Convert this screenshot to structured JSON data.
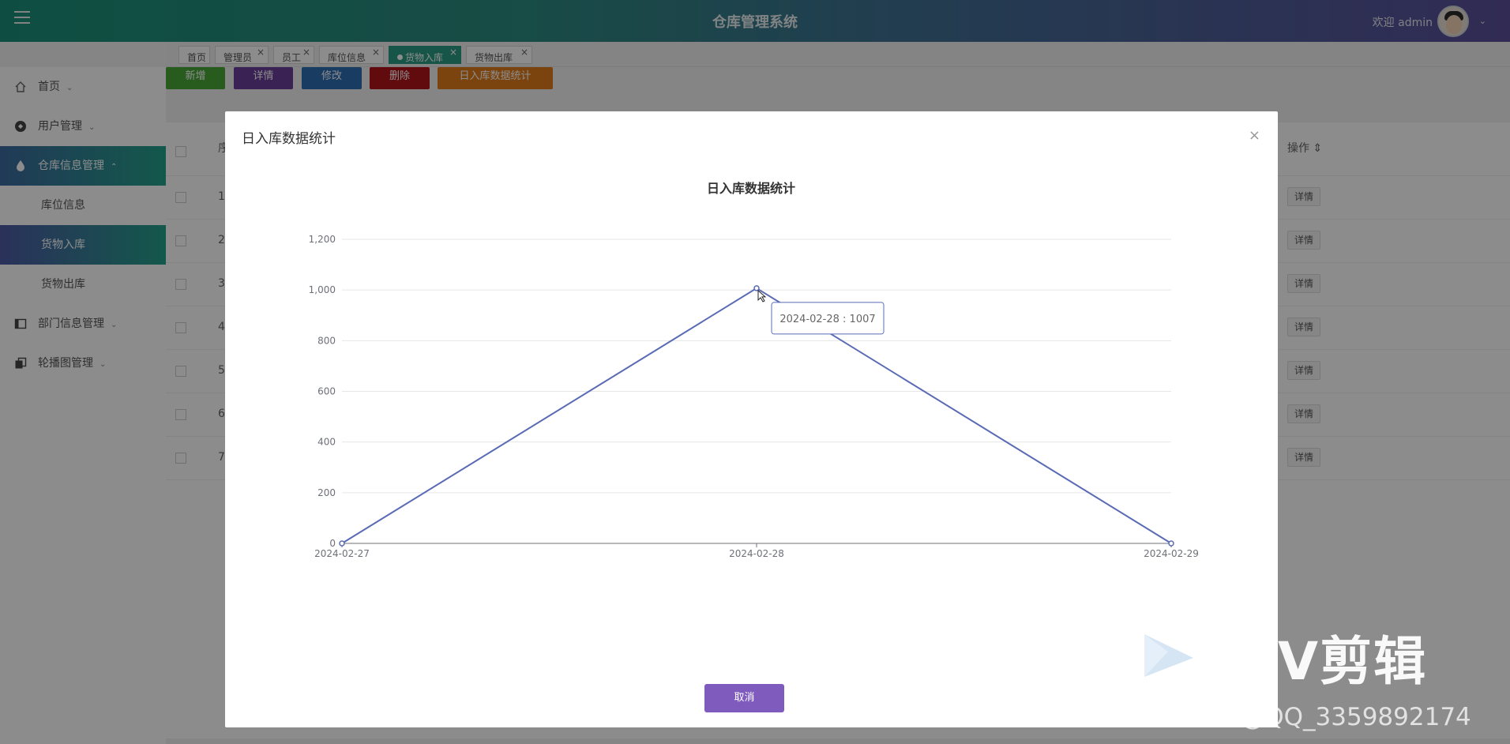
{
  "header": {
    "title": "仓库管理系统",
    "welcome": "欢迎 admin"
  },
  "tabs": [
    {
      "label": "首页",
      "closable": false,
      "active": false
    },
    {
      "label": "管理员",
      "closable": true,
      "active": false
    },
    {
      "label": "员工",
      "closable": true,
      "active": false
    },
    {
      "label": "库位信息",
      "closable": true,
      "active": false
    },
    {
      "label": "货物入库",
      "closable": true,
      "active": true
    },
    {
      "label": "货物出库",
      "closable": true,
      "active": false
    }
  ],
  "sidebar": {
    "items": [
      {
        "label": "首页"
      },
      {
        "label": "用户管理"
      },
      {
        "label": "仓库信息管理"
      },
      {
        "label": "库位信息"
      },
      {
        "label": "货物入库"
      },
      {
        "label": "货物出库"
      },
      {
        "label": "部门信息管理"
      },
      {
        "label": "轮播图管理"
      }
    ]
  },
  "toolbar": {
    "add": "新增",
    "detail": "详情",
    "edit": "修改",
    "delete": "删除",
    "stats": "日入库数据统计",
    "colors": {
      "add": "#49a83a",
      "detail": "#6a3f9b",
      "edit": "#2c6db3",
      "delete": "#b3141a",
      "stats": "#e07b1a"
    }
  },
  "table": {
    "col_seq": "序",
    "col_op": "操作",
    "rows": [
      "1",
      "2",
      "3",
      "4",
      "5",
      "6",
      "7"
    ],
    "detail_label": "详情"
  },
  "modal": {
    "title": "日入库数据统计",
    "close": "×",
    "cancel": "取消",
    "tooltip": "2024-02-28 : 1007"
  },
  "chart_data": {
    "type": "line",
    "title": "日入库数据统计",
    "categories": [
      "2024-02-27",
      "2024-02-28",
      "2024-02-29"
    ],
    "series": [
      {
        "values": [
          0,
          1007,
          0
        ]
      }
    ],
    "ylim": [
      0,
      1200
    ],
    "yticks": [
      0,
      200,
      400,
      600,
      800,
      1000,
      1200
    ],
    "grid": true,
    "color": "#5a6bb5"
  },
  "watermark": {
    "brand": "V剪辑",
    "credit": "CSDN @QQ_3359892174"
  }
}
